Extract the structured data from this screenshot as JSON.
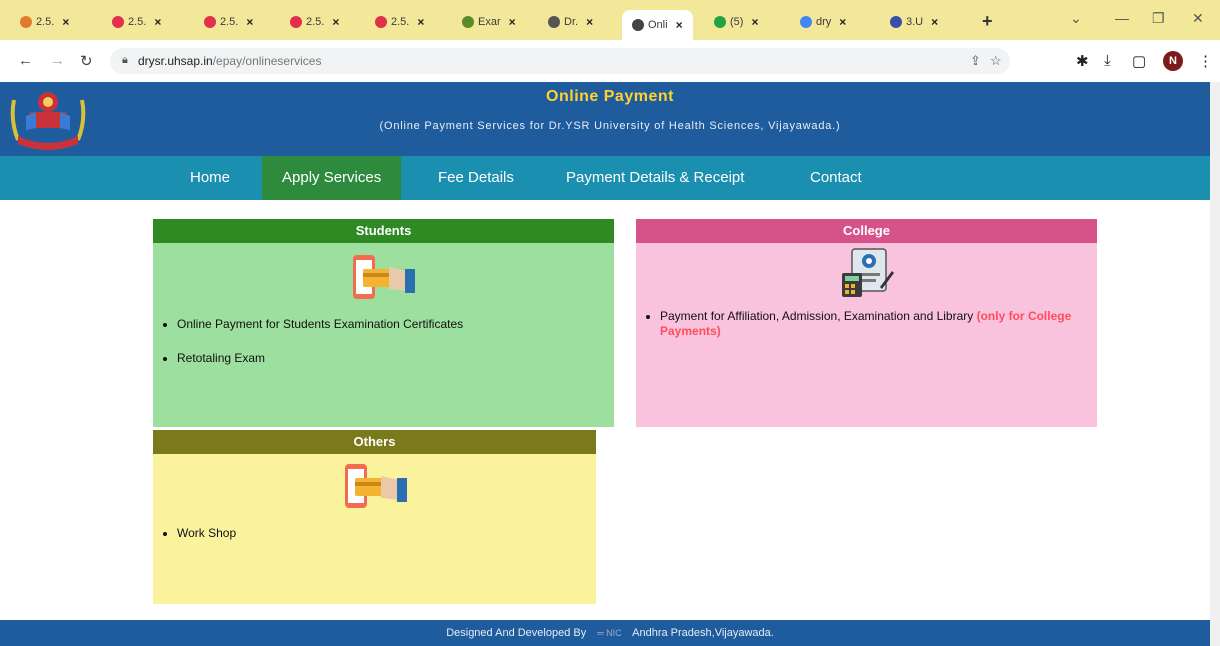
{
  "browser": {
    "tabs": [
      {
        "label": "2.5."
      },
      {
        "label": "2.5."
      },
      {
        "label": "2.5."
      },
      {
        "label": "2.5."
      },
      {
        "label": "2.5."
      },
      {
        "label": "Exar"
      },
      {
        "label": "Dr."
      },
      {
        "label": "Onli"
      },
      {
        "label": "(5)"
      },
      {
        "label": "dry"
      },
      {
        "label": "3.U"
      }
    ],
    "url_host": "drysr.uhsap.in",
    "url_path": "/epay/onlineservices",
    "profile_initial": "N"
  },
  "header": {
    "title": "Online Payment",
    "subtitle": "(Online Payment Services for Dr.YSR University of Health Sciences, Vijayawada.)"
  },
  "nav": {
    "items": [
      "Home",
      "Apply Services",
      "Fee Details",
      "Payment Details & Receipt",
      "Contact"
    ]
  },
  "panels": {
    "students": {
      "title": "Students",
      "items": [
        "Online Payment for Students Examination Certificates",
        "Retotaling Exam"
      ]
    },
    "college": {
      "title": "College",
      "item_text": "Payment for Affiliation, Admission, Examination and Library ",
      "item_highlight": "(only for College Payments)"
    },
    "others": {
      "title": "Others",
      "items": [
        "Work Shop"
      ]
    }
  },
  "footer": {
    "left": "Designed And Developed By",
    "right": "Andhra Pradesh,Vijayawada."
  },
  "colors": {
    "students_head": "#2f8a24",
    "students_body": "#9ddf9e",
    "college_head": "#d6528a",
    "college_body": "#f9c3de",
    "others_head": "#7a7a1a",
    "others_body": "#faf29c"
  }
}
